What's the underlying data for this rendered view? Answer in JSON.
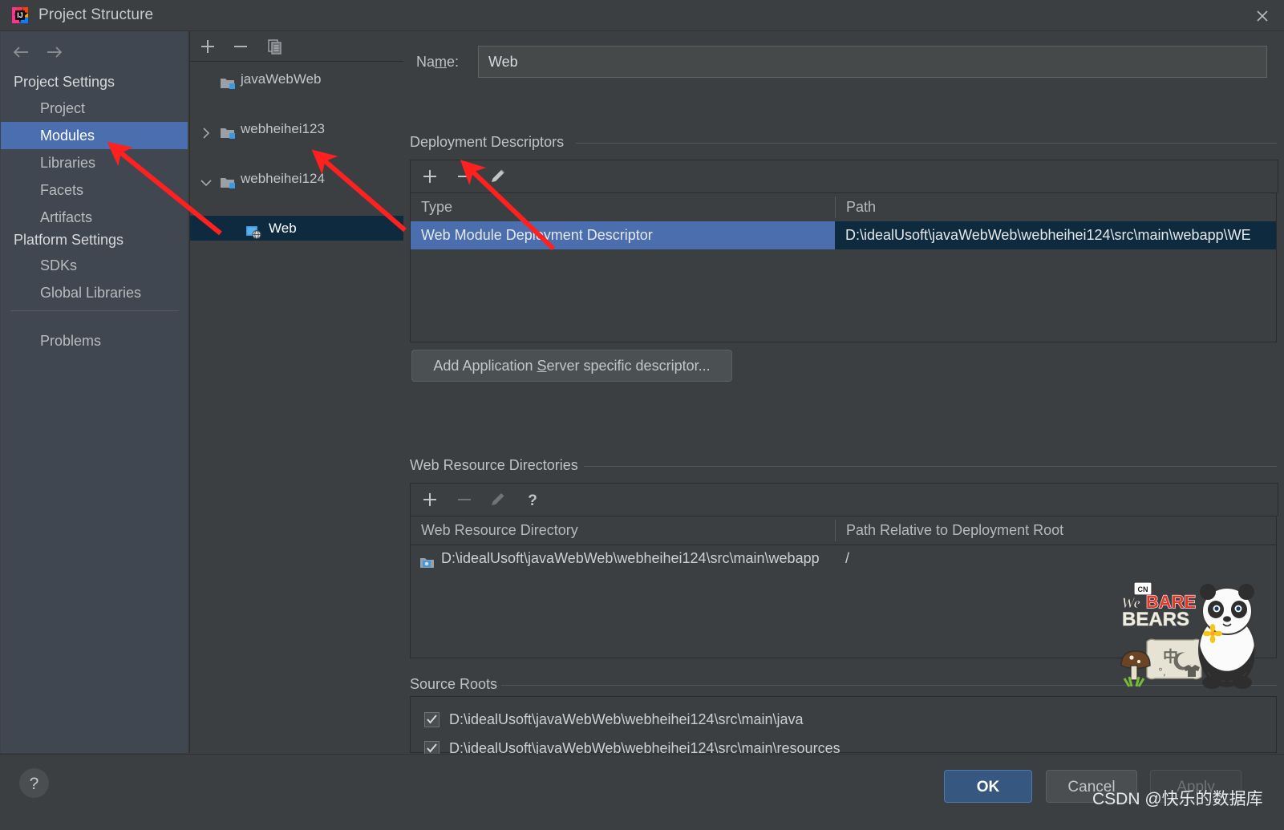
{
  "window": {
    "title": "Project Structure",
    "app_icon": "intellij-idea-icon",
    "close_icon": "close-icon"
  },
  "sidebar": {
    "nav": {
      "back_icon": "arrow-left-icon",
      "forward_icon": "arrow-right-icon"
    },
    "groups": [
      {
        "label": "Project Settings"
      },
      {
        "label": "Platform Settings"
      }
    ],
    "items": [
      {
        "label": "Project",
        "selected": false
      },
      {
        "label": "Modules",
        "selected": true
      },
      {
        "label": "Libraries",
        "selected": false
      },
      {
        "label": "Facets",
        "selected": false
      },
      {
        "label": "Artifacts",
        "selected": false
      },
      {
        "label": "SDKs",
        "selected": false
      },
      {
        "label": "Global Libraries",
        "selected": false
      },
      {
        "label": "Problems",
        "selected": false
      }
    ]
  },
  "tree": {
    "toolbar": [
      {
        "name": "add-module-button",
        "icon": "plus-icon"
      },
      {
        "name": "remove-module-button",
        "icon": "minus-icon"
      },
      {
        "name": "copy-module-button",
        "icon": "copy-icon"
      }
    ],
    "nodes": [
      {
        "label": "javaWebWeb",
        "icon": "module-folder-icon",
        "twisty": "none",
        "indent": 38,
        "selected": false
      },
      {
        "label": "webheihei123",
        "icon": "module-folder-icon",
        "twisty": "collapsed",
        "indent": 38,
        "selected": false
      },
      {
        "label": "webheihei124",
        "icon": "module-folder-icon",
        "twisty": "expanded",
        "indent": 38,
        "selected": false
      },
      {
        "label": "Web",
        "icon": "web-facet-icon",
        "twisty": "none",
        "indent": 70,
        "selected": true
      }
    ]
  },
  "main": {
    "name_field": {
      "label_prefix": "Na",
      "label_mnemonic": "m",
      "label_suffix": "e:",
      "value": "Web",
      "placeholder": ""
    },
    "deployment_descriptors": {
      "section_title": "Deployment Descriptors",
      "toolbar": [
        {
          "name": "add-descriptor-button",
          "icon": "plus-icon",
          "enabled": true
        },
        {
          "name": "remove-descriptor-button",
          "icon": "minus-icon",
          "enabled": true
        },
        {
          "name": "edit-descriptor-button",
          "icon": "pencil-icon",
          "enabled": true
        }
      ],
      "columns": [
        "Type",
        "Path"
      ],
      "rows": [
        {
          "type": "Web Module Deployment Descriptor",
          "path": "D:\\idealUsoft\\javaWebWeb\\webheihei124\\src\\main\\webapp\\WE",
          "selected": true
        }
      ],
      "add_button": {
        "prefix": "Add Application ",
        "mnemonic": "S",
        "suffix": "erver specific descriptor..."
      }
    },
    "web_resource_directories": {
      "section_title": "Web Resource Directories",
      "toolbar": [
        {
          "name": "add-web-resource-button",
          "icon": "plus-icon",
          "enabled": true
        },
        {
          "name": "remove-web-resource-button",
          "icon": "minus-icon",
          "enabled": false
        },
        {
          "name": "edit-web-resource-button",
          "icon": "pencil-icon",
          "enabled": false
        },
        {
          "name": "help-web-resource-button",
          "icon": "question-icon",
          "enabled": true
        }
      ],
      "columns": [
        "Web Resource Directory",
        "Path Relative to Deployment Root"
      ],
      "rows": [
        {
          "directory": "D:\\idealUsoft\\javaWebWeb\\webheihei124\\src\\main\\webapp",
          "icon": "folder-web-icon",
          "relative_path": "/"
        }
      ]
    },
    "source_roots": {
      "section_title": "Source Roots",
      "rows": [
        {
          "checked": true,
          "path": "D:\\idealUsoft\\javaWebWeb\\webheihei124\\src\\main\\java"
        },
        {
          "checked": true,
          "path": "D:\\idealUsoft\\javaWebWeb\\webheihei124\\src\\main\\resources"
        }
      ]
    }
  },
  "footer": {
    "help_icon": "question-icon",
    "ok_label": "OK",
    "cancel_label": "Cancel",
    "apply_label": "Apply"
  },
  "overlay": {
    "watermark": "CSDN @快乐的数据库",
    "sticker": {
      "network_tag": "CN",
      "line1": "We",
      "line2": "BARE",
      "line3": "BEARS",
      "char_zh": "中"
    },
    "annotation_arrows": 3,
    "arrow_color": "#ff2020"
  },
  "colors": {
    "background": "#3c3f41",
    "sidebar_background": "#414750",
    "selection_blue": "#4b6eaf",
    "selection_navy": "#0d2a3f",
    "ok_button": "#365880",
    "text": "#c3c6c9"
  }
}
